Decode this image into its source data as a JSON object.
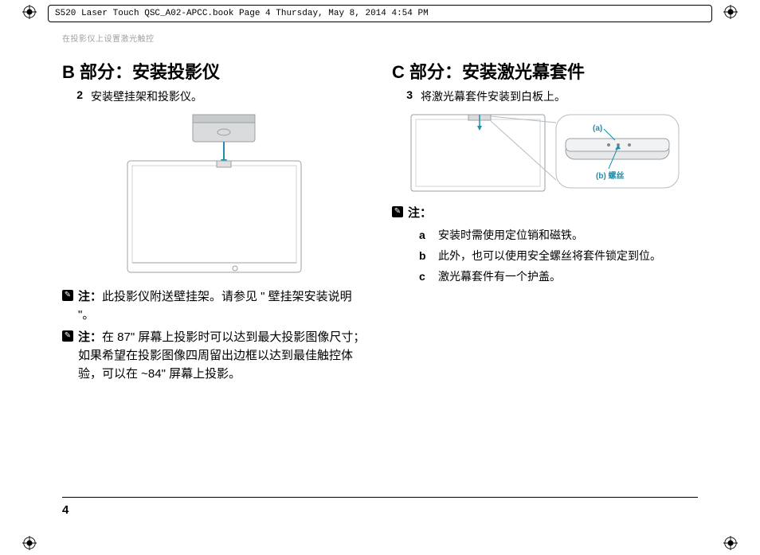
{
  "header": "S520 Laser Touch QSC_A02-APCC.book  Page 4  Thursday, May 8, 2014  4:54 PM",
  "running_head": "在投影仪上设置激光触控",
  "left": {
    "title": "B 部分：安装投影仪",
    "step_num": "2",
    "step_text": "安装壁挂架和投影仪。",
    "note1_label": "注：",
    "note1_text": "此投影仪附送壁挂架。请参见 \" 壁挂架安装说明 \"。",
    "note2_label": "注：",
    "note2_text": "在 87\" 屏幕上投影时可以达到最大投影图像尺寸；如果希望在投影图像四周留出边框以达到最佳触控体验，可以在 ~84\" 屏幕上投影。"
  },
  "right": {
    "title": "C 部分：安装激光幕套件",
    "step_num": "3",
    "step_text": "将激光幕套件安装到白板上。",
    "callout_a": "(a)",
    "callout_b": "(b) 螺丝",
    "note_label": "注：",
    "items": {
      "a": {
        "letter": "a",
        "text": "安装时需使用定位销和磁铁。"
      },
      "b": {
        "letter": "b",
        "text": "此外，也可以使用安全螺丝将套件锁定到位。"
      },
      "c": {
        "letter": "c",
        "text": "激光幕套件有一个护盖。"
      }
    }
  },
  "page_number": "4"
}
